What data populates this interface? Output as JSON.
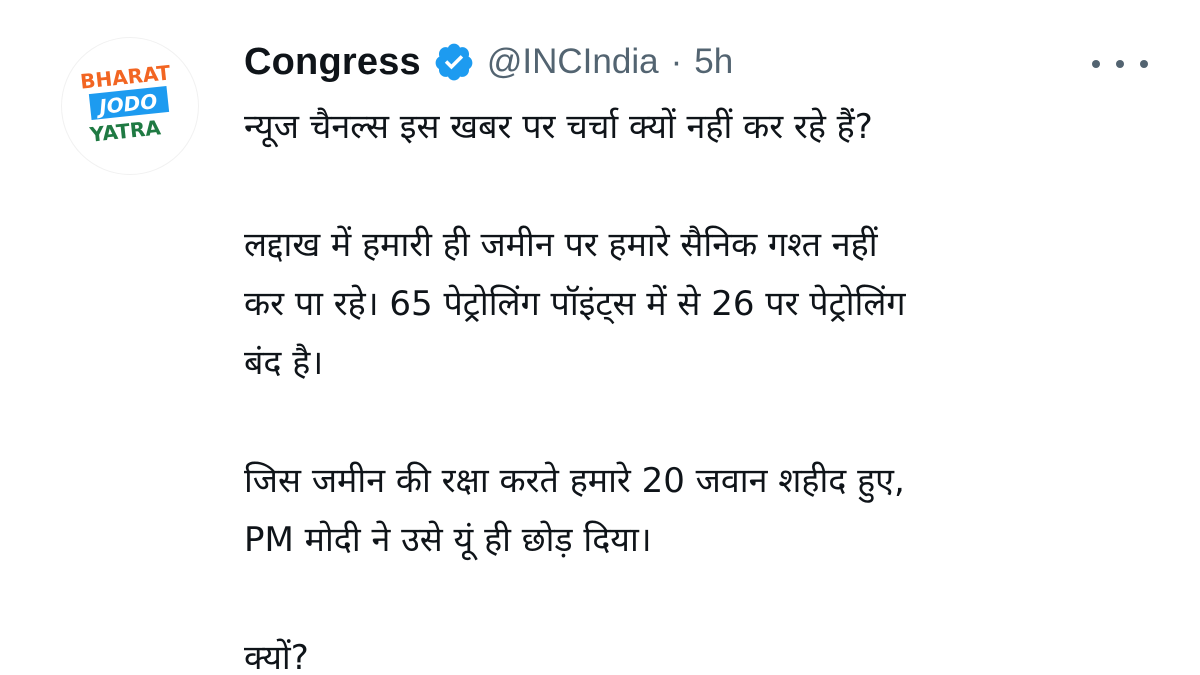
{
  "author": {
    "name": "Congress",
    "handle": "@INCIndia",
    "separator": "·",
    "time": "5h",
    "avatar": {
      "line1": "BHARAT",
      "line2": "JODO",
      "line3": "YATRA"
    }
  },
  "icons": {
    "verified": "verified-badge-icon",
    "more": "more-options-icon"
  },
  "colors": {
    "verified_blue": "#1d9bf0",
    "avatar_orange": "#f26522",
    "avatar_blue": "#1d9bf0",
    "avatar_green": "#1f7a43",
    "secondary_text": "#536471"
  },
  "tweet": {
    "line1": "न्यूज चैनल्स इस खबर पर चर्चा क्यों नहीं कर रहे हैं?",
    "line2": "लद्दाख में हमारी ही जमीन पर हमारे सैनिक गश्त नहीं",
    "line3": "कर पा रहे। 65 पेट्रोलिंग पॉइंट्स में से 26 पर पेट्रोलिंग",
    "line4": "बंद है।",
    "line5": "जिस जमीन की रक्षा करते हमारे 20 जवान शहीद हुए,",
    "line6": "PM मोदी ने उसे यूं ही छोड़ दिया।",
    "line7": "क्यों?"
  }
}
